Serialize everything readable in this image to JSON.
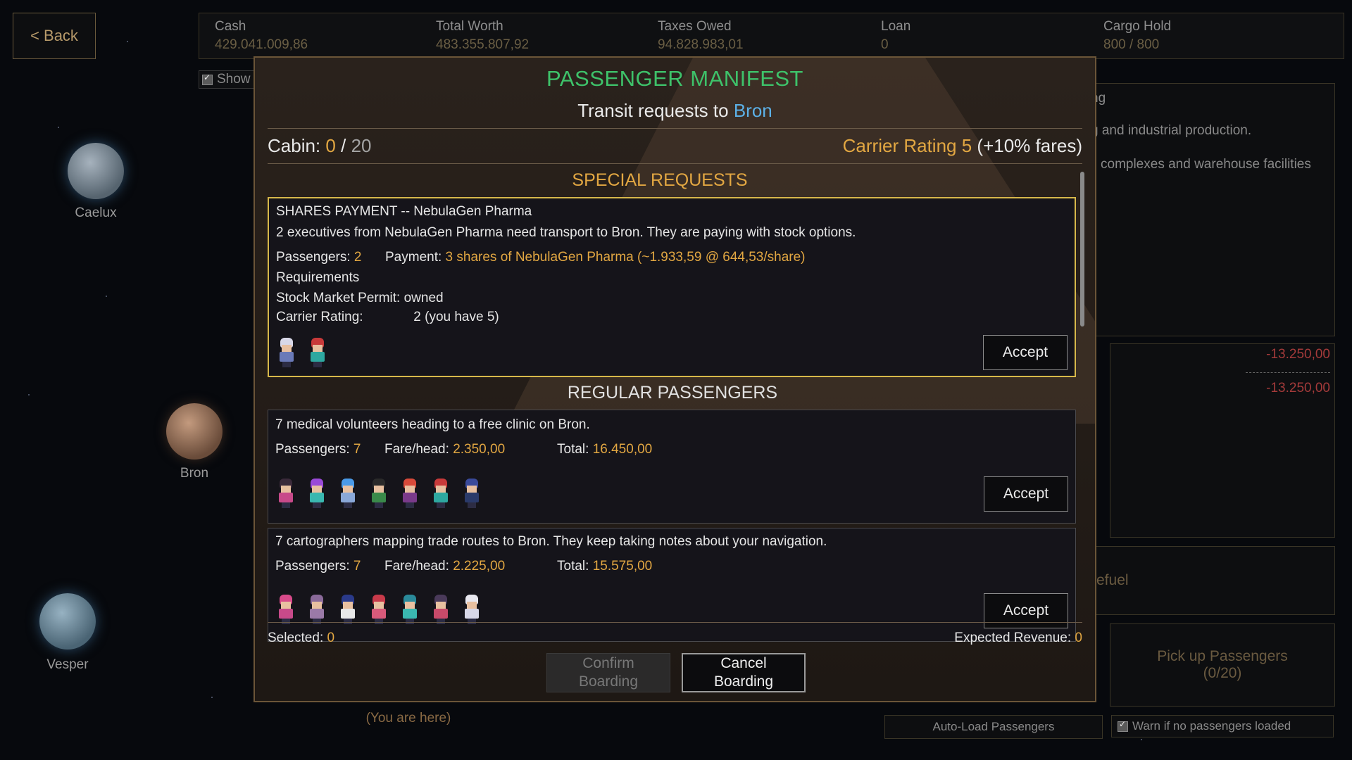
{
  "top_bar": {
    "back_label": "< Back",
    "stats": [
      {
        "label": "Cash",
        "value": "429.041.009,86"
      },
      {
        "label": "Total Worth",
        "value": "483.355.807,92"
      },
      {
        "label": "Taxes Owed",
        "value": "94.828.983,01"
      },
      {
        "label": "Loan",
        "value": "0"
      },
      {
        "label": "Cargo Hold",
        "value": "800 / 800"
      }
    ],
    "show_toggle_label": "Show"
  },
  "map": {
    "planets": [
      {
        "name": "Caelux",
        "color": "#6f8090"
      },
      {
        "name": "Bron",
        "color": "#8a6a54"
      },
      {
        "name": "Vesper",
        "color": "#6a8494"
      }
    ],
    "current_location_note": "(You are here)"
  },
  "side_panel": {
    "desc_lines": [
      "ng",
      "g and industrial production.",
      "complexes and warehouse facilities"
    ],
    "cost_1": "-13.250,00",
    "cost_2": "-13.250,00",
    "refuel_label": "efuel",
    "pickup_label_1": "Pick up Passengers",
    "pickup_label_2": "(0/20)",
    "autoload_label": "Auto-Load Passengers",
    "warn_label": "Warn if no passengers loaded"
  },
  "manifest": {
    "title": "PASSENGER MANIFEST",
    "subtitle_prefix": "Transit requests to",
    "destination": "Bron",
    "cabin_label": "Cabin:",
    "cabin_used": "0",
    "cabin_sep": "/",
    "cabin_capacity": "20",
    "carrier_rating_label": "Carrier Rating",
    "carrier_rating_value": "5",
    "carrier_rating_bonus": "(+10% fares)",
    "special_title": "SPECIAL REQUESTS",
    "special": {
      "header": "SHARES PAYMENT  --  NebulaGen Pharma",
      "description": "2 executives from NebulaGen Pharma need transport to Bron. They are paying with stock options.",
      "passengers_label": "Passengers:",
      "passengers": "2",
      "payment_label": "Payment:",
      "payment": "3 shares of NebulaGen Pharma (~1.933,59 @ 644,53/share)",
      "requirements_label": "Requirements",
      "req1_label": "Stock Market Permit:",
      "req1_value": "owned",
      "req2_label": "Carrier Rating:",
      "req2_value": "2 (you have 5)",
      "accept_label": "Accept"
    },
    "regular_title": "REGULAR PASSENGERS",
    "regular": [
      {
        "description": "7 medical volunteers heading to a free clinic on Bron.",
        "passengers_label": "Passengers:",
        "passengers": "7",
        "fare_label": "Fare/head:",
        "fare": "2.350,00",
        "total_label": "Total:",
        "total": "16.450,00",
        "accept_label": "Accept"
      },
      {
        "description": "7 cartographers mapping trade routes to Bron. They keep taking notes about your navigation.",
        "passengers_label": "Passengers:",
        "passengers": "7",
        "fare_label": "Fare/head:",
        "fare": "2.225,00",
        "total_label": "Total:",
        "total": "15.575,00",
        "accept_label": "Accept"
      }
    ],
    "selected_label": "Selected:",
    "selected_value": "0",
    "revenue_label": "Expected Revenue:",
    "revenue_value": "0",
    "confirm_label_1": "Confirm",
    "confirm_label_2": "Boarding",
    "cancel_label_1": "Cancel",
    "cancel_label_2": "Boarding"
  },
  "colors": {
    "title_green": "#3ec26a",
    "gold": "#e2a742",
    "requirement_green": "#69c75a",
    "destination_blue": "#5cb0e6",
    "special_border": "#d7b84a"
  }
}
